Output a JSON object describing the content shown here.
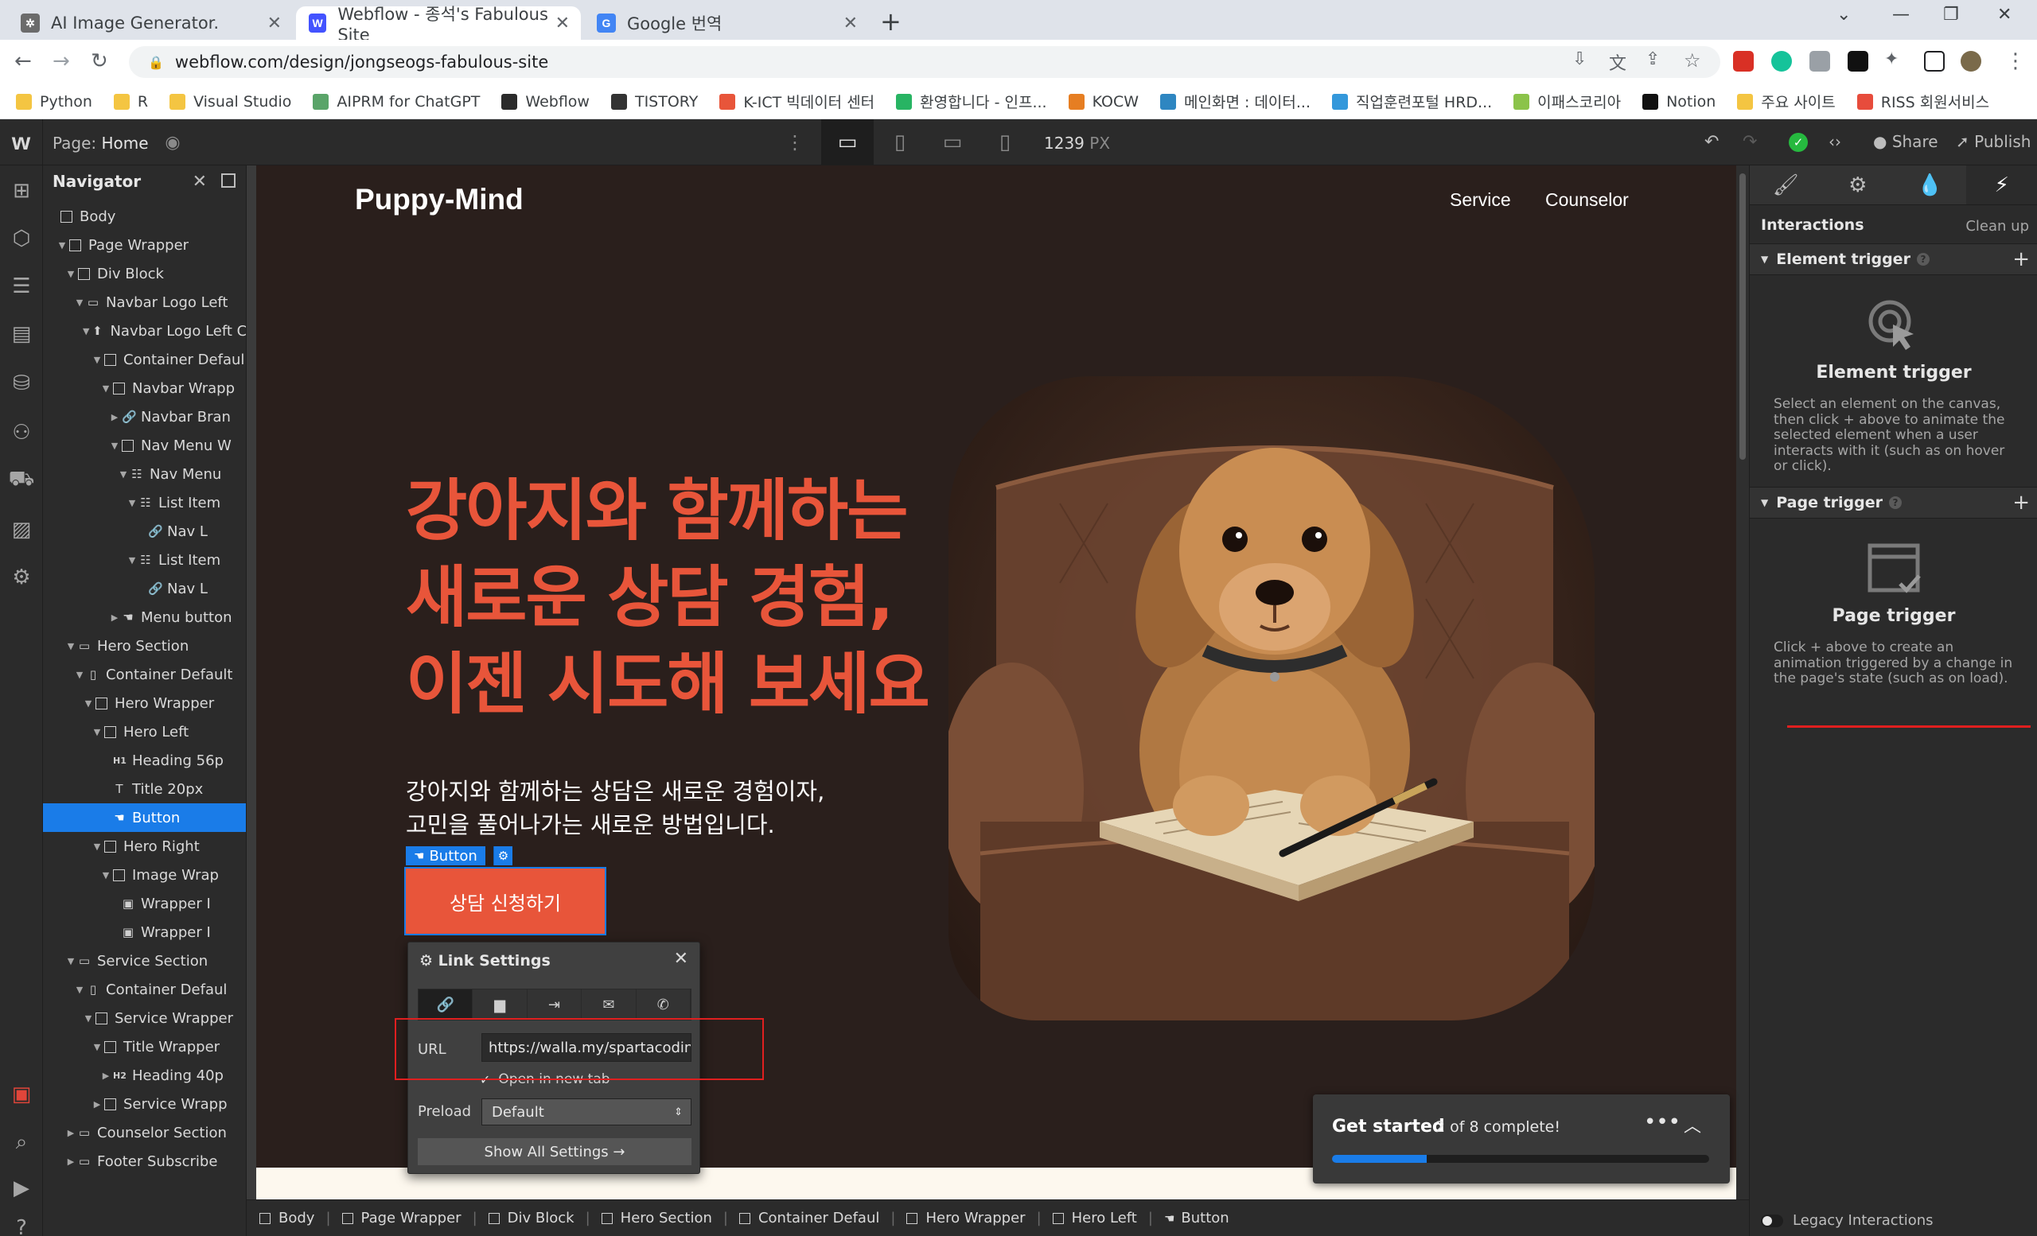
{
  "browser": {
    "tabs": [
      {
        "title": "AI Image Generator.",
        "favicon_color": "#6b6b6b",
        "favicon_glyph": "✲"
      },
      {
        "title": "Webflow - 종석's Fabulous Site",
        "favicon_color": "#4353ff",
        "favicon_glyph": "W"
      },
      {
        "title": "Google 번역",
        "favicon_color": "#4285f4",
        "favicon_glyph": "G"
      }
    ],
    "url": "webflow.com/design/jongseogs-fabulous-site",
    "bookmarks": [
      {
        "label": "Python",
        "color": "#f4c542"
      },
      {
        "label": "R",
        "color": "#f4c542"
      },
      {
        "label": "Visual Studio",
        "color": "#f4c542"
      },
      {
        "label": "AIPRM for ChatGPT",
        "color": "#5aa469"
      },
      {
        "label": "Webflow",
        "color": "#2b2b2b"
      },
      {
        "label": "TISTORY",
        "color": "#333333"
      },
      {
        "label": "K-ICT 빅데이터 센터",
        "color": "#e8553a"
      },
      {
        "label": "환영합니다 - 인프...",
        "color": "#28b463"
      },
      {
        "label": "KOCW",
        "color": "#e67e22"
      },
      {
        "label": "메인화면 : 데이터...",
        "color": "#2e86c1"
      },
      {
        "label": "직업훈련포털 HRD...",
        "color": "#3498db"
      },
      {
        "label": "이패스코리아",
        "color": "#8bc34a"
      },
      {
        "label": "Notion",
        "color": "#111111"
      },
      {
        "label": "주요 사이트",
        "color": "#f4c542"
      },
      {
        "label": "RISS 회원서비스",
        "color": "#e74c3c"
      }
    ]
  },
  "webflow_top": {
    "page_label": "Page:",
    "page_name": "Home",
    "width_value": "1239",
    "width_unit": "PX",
    "share": "Share",
    "publish": "Publish"
  },
  "navigator": {
    "title": "Navigator",
    "items": [
      {
        "label": "Body",
        "depth": 0,
        "caret": "",
        "icon": "box"
      },
      {
        "label": "Page Wrapper",
        "depth": 1,
        "caret": "▼",
        "icon": "box"
      },
      {
        "label": "Div Block",
        "depth": 2,
        "caret": "▼",
        "icon": "box"
      },
      {
        "label": "Navbar Logo Left",
        "depth": 3,
        "caret": "▼",
        "icon": "section"
      },
      {
        "label": "Navbar Logo Left C",
        "depth": 4,
        "caret": "▼",
        "icon": "component"
      },
      {
        "label": "Container Defaul",
        "depth": 5,
        "caret": "▼",
        "icon": "box"
      },
      {
        "label": "Navbar Wrapp",
        "depth": 6,
        "caret": "▼",
        "icon": "box"
      },
      {
        "label": "Navbar Bran",
        "depth": 7,
        "caret": "▶",
        "icon": "link"
      },
      {
        "label": "Nav Menu W",
        "depth": 7,
        "caret": "▼",
        "icon": "box"
      },
      {
        "label": "Nav Menu",
        "depth": 8,
        "caret": "▼",
        "icon": "list"
      },
      {
        "label": "List Item",
        "depth": 9,
        "caret": "▼",
        "icon": "list"
      },
      {
        "label": "Nav L",
        "depth": 10,
        "caret": "",
        "icon": "link"
      },
      {
        "label": "List Item",
        "depth": 9,
        "caret": "▼",
        "icon": "list"
      },
      {
        "label": "Nav L",
        "depth": 10,
        "caret": "",
        "icon": "link"
      },
      {
        "label": "Menu button",
        "depth": 7,
        "caret": "▶",
        "icon": "hand"
      },
      {
        "label": "Hero Section",
        "depth": 2,
        "caret": "▼",
        "icon": "section"
      },
      {
        "label": "Container Default",
        "depth": 3,
        "caret": "▼",
        "icon": "container"
      },
      {
        "label": "Hero Wrapper",
        "depth": 4,
        "caret": "▼",
        "icon": "box"
      },
      {
        "label": "Hero Left",
        "depth": 5,
        "caret": "▼",
        "icon": "box"
      },
      {
        "label": "Heading 56p",
        "depth": 6,
        "caret": "",
        "icon": "h1"
      },
      {
        "label": "Title 20px",
        "depth": 6,
        "caret": "",
        "icon": "text"
      },
      {
        "label": "Button",
        "depth": 6,
        "caret": "",
        "icon": "hand",
        "selected": true
      },
      {
        "label": "Hero Right",
        "depth": 5,
        "caret": "▼",
        "icon": "box"
      },
      {
        "label": "Image Wrap",
        "depth": 6,
        "caret": "▼",
        "icon": "box"
      },
      {
        "label": "Wrapper I",
        "depth": 7,
        "caret": "",
        "icon": "image"
      },
      {
        "label": "Wrapper I",
        "depth": 7,
        "caret": "",
        "icon": "image"
      },
      {
        "label": "Service Section",
        "depth": 2,
        "caret": "▼",
        "icon": "section"
      },
      {
        "label": "Container Defaul",
        "depth": 3,
        "caret": "▼",
        "icon": "container"
      },
      {
        "label": "Service Wrapper",
        "depth": 4,
        "caret": "▼",
        "icon": "box"
      },
      {
        "label": "Title Wrapper",
        "depth": 5,
        "caret": "▼",
        "icon": "box"
      },
      {
        "label": "Heading 40p",
        "depth": 6,
        "caret": "▶",
        "icon": "h2"
      },
      {
        "label": "Service Wrapp",
        "depth": 5,
        "caret": "▶",
        "icon": "box"
      },
      {
        "label": "Counselor Section",
        "depth": 2,
        "caret": "▶",
        "icon": "section"
      },
      {
        "label": "Footer Subscribe",
        "depth": 2,
        "caret": "▶",
        "icon": "section"
      }
    ]
  },
  "canvas": {
    "brand": "Puppy-Mind",
    "menu": [
      "Service",
      "Counselor"
    ],
    "headline": [
      "강아지와 함께하는",
      "새로운 상담 경험,",
      "이젠 시도해 보세요"
    ],
    "subtitle": [
      "강아지와 함께하는 상담은 새로운 경험이자,",
      "고민을 풀어나가는 새로운 방법입니다."
    ],
    "selected_label": "Button",
    "cta": "상담 신청하기"
  },
  "link_settings": {
    "title": "Link Settings",
    "url_label": "URL",
    "url_value": "https://walla.my/spartacoding",
    "open_new_tab": "Open in new tab",
    "preload_label": "Preload",
    "preload_value": "Default",
    "show_all": "Show All Settings →"
  },
  "get_started": {
    "title": "Get started",
    "status": "2 of 8 complete!",
    "progress": 0.25
  },
  "breadcrumb": [
    "Body",
    "Page Wrapper",
    "Div Block",
    "Hero Section",
    "Container Defaul",
    "Hero Wrapper",
    "Hero Left",
    "Button"
  ],
  "right_panel": {
    "title": "Interactions",
    "cleanup": "Clean up",
    "element_trigger": {
      "section": "Element trigger",
      "title": "Element trigger",
      "desc": "Select an element on the canvas, then click + above to animate the selected element when a user interacts with it (such as on hover or click)."
    },
    "page_trigger": {
      "section": "Page trigger",
      "title": "Page trigger",
      "desc": "Click + above to create an animation triggered by a change in the page's state (such as on load)."
    },
    "legacy": "Legacy Interactions"
  },
  "colors": {
    "accent": "#1a7ce8",
    "brand_orange": "#e8553a",
    "canvas_bg": "#2a1f1c",
    "success": "#26b93f"
  }
}
